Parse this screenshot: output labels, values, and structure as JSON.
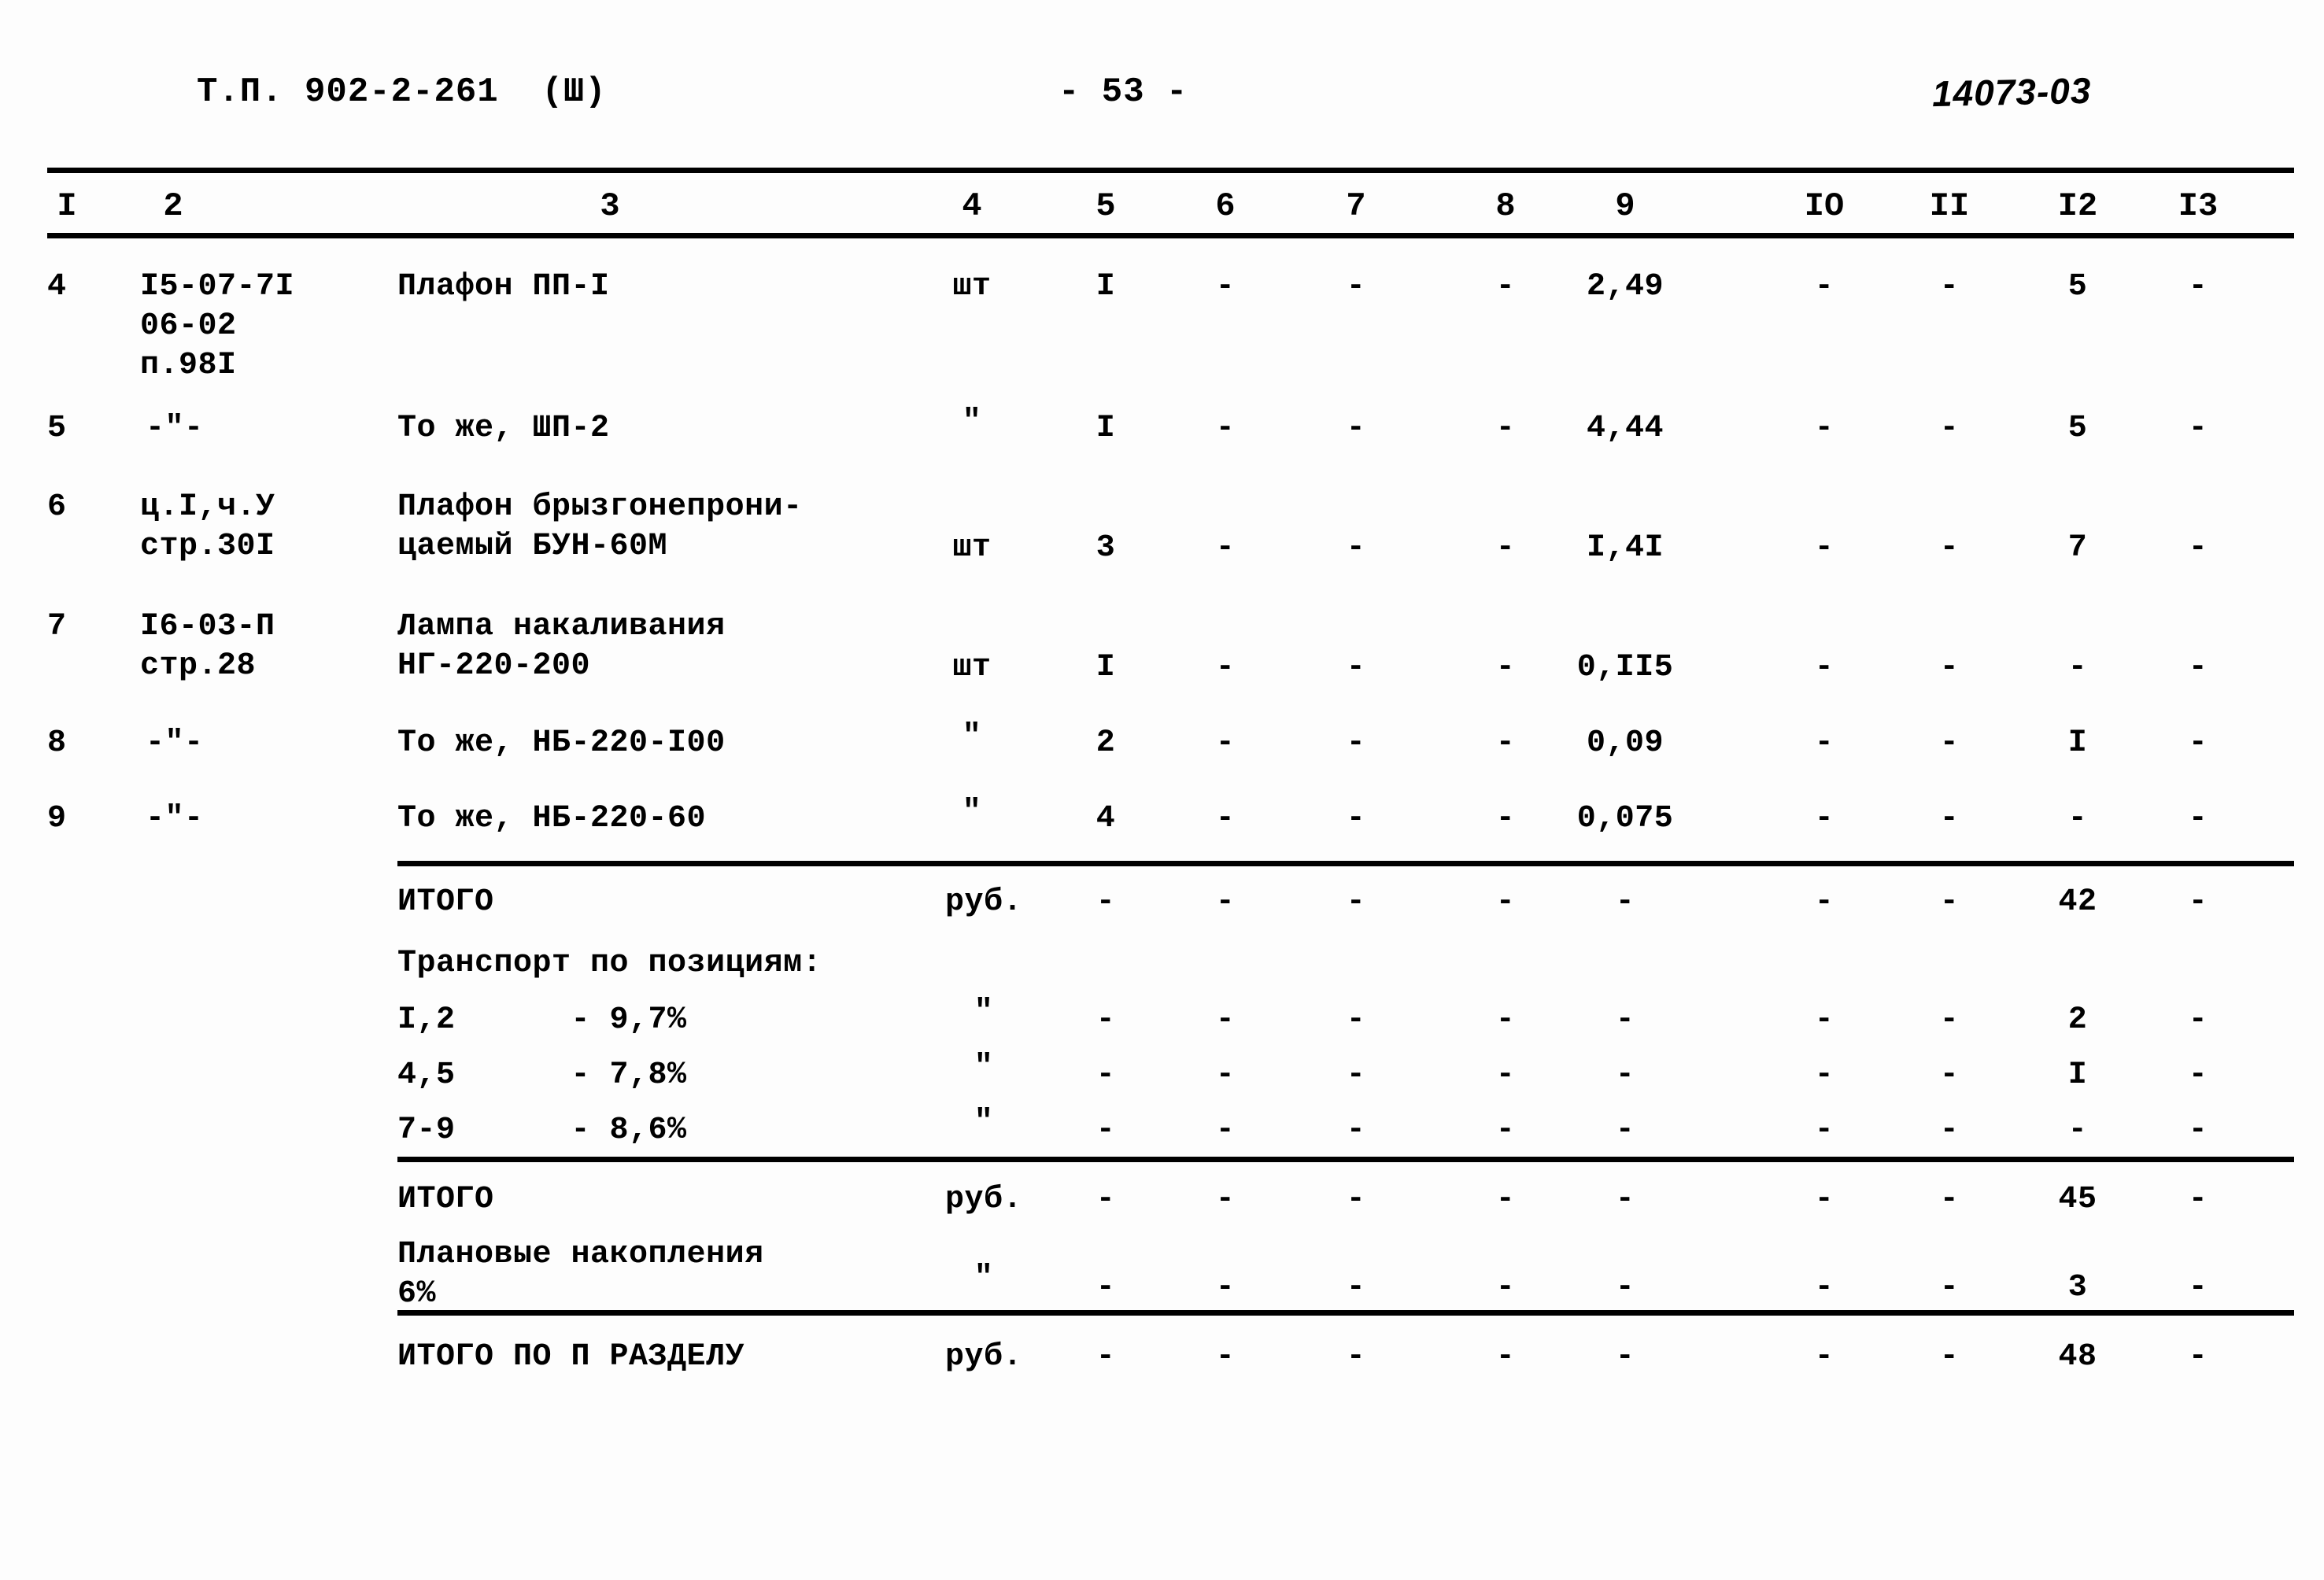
{
  "header": {
    "doc_code": "Т.П. 902-2-261  (Ш)",
    "page_number": "- 53 -",
    "drawing_number": "14073-03"
  },
  "table": {
    "column_headers": [
      "I",
      "2",
      "3",
      "4",
      "5",
      "6",
      "7",
      "8",
      "9",
      "IO",
      "II",
      "I2",
      "I3"
    ],
    "rows": [
      {
        "pos": "4",
        "ref": "I5-07-7I\n06-02\nп.98I",
        "name": "Плафон ПП-I",
        "unit": "шт",
        "qty": "I",
        "c6": "-",
        "c7": "-",
        "c8": "-",
        "c9": "2,49",
        "c10": "-",
        "c11": "-",
        "c12": "5",
        "c13": "-"
      },
      {
        "pos": "5",
        "ref": "-\"-",
        "name": "То же, ШП-2",
        "unit": "\"",
        "qty": "I",
        "c6": "-",
        "c7": "-",
        "c8": "-",
        "c9": "4,44",
        "c10": "-",
        "c11": "-",
        "c12": "5",
        "c13": "-"
      },
      {
        "pos": "6",
        "ref": "ц.I,ч.У\nстр.30I",
        "name": "Плафон брызгонепрони-\nцаемый БУН-60М",
        "unit": "шт",
        "qty": "3",
        "c6": "-",
        "c7": "-",
        "c8": "-",
        "c9": "I,4I",
        "c10": "-",
        "c11": "-",
        "c12": "7",
        "c13": "-"
      },
      {
        "pos": "7",
        "ref": "I6-03-П\nстр.28",
        "name": "Лампа накаливания\nНГ-220-200",
        "unit": "шт",
        "qty": "I",
        "c6": "-",
        "c7": "-",
        "c8": "-",
        "c9": "0,II5",
        "c10": "-",
        "c11": "-",
        "c12": "-",
        "c13": "-"
      },
      {
        "pos": "8",
        "ref": "-\"-",
        "name": "То же, НБ-220-I00",
        "unit": "\"",
        "qty": "2",
        "c6": "-",
        "c7": "-",
        "c8": "-",
        "c9": "0,09",
        "c10": "-",
        "c11": "-",
        "c12": "I",
        "c13": "-"
      },
      {
        "pos": "9",
        "ref": "-\"-",
        "name": "То же, НБ-220-60",
        "unit": "\"",
        "qty": "4",
        "c6": "-",
        "c7": "-",
        "c8": "-",
        "c9": "0,075",
        "c10": "-",
        "c11": "-",
        "c12": "-",
        "c13": "-"
      }
    ],
    "totals": [
      {
        "label": "ИТОГО",
        "unit": "руб.",
        "qty": "-",
        "c6": "-",
        "c7": "-",
        "c8": "-",
        "c9": "-",
        "c10": "-",
        "c11": "-",
        "c12": "42",
        "c13": "-"
      },
      {
        "label": "Транспорт по позициям:",
        "unit": "",
        "qty": "",
        "c6": "",
        "c7": "",
        "c8": "",
        "c9": "",
        "c10": "",
        "c11": "",
        "c12": "",
        "c13": ""
      },
      {
        "label": "I,2      - 9,7%",
        "unit": "\"",
        "qty": "-",
        "c6": "-",
        "c7": "-",
        "c8": "-",
        "c9": "-",
        "c10": "-",
        "c11": "-",
        "c12": "2",
        "c13": "-"
      },
      {
        "label": "4,5      - 7,8%",
        "unit": "\"",
        "qty": "-",
        "c6": "-",
        "c7": "-",
        "c8": "-",
        "c9": "-",
        "c10": "-",
        "c11": "-",
        "c12": "I",
        "c13": "-"
      },
      {
        "label": "7-9      - 8,6%",
        "unit": "\"",
        "qty": "-",
        "c6": "-",
        "c7": "-",
        "c8": "-",
        "c9": "-",
        "c10": "-",
        "c11": "-",
        "c12": "-",
        "c13": "-"
      },
      {
        "label": "ИТОГО",
        "unit": "руб.",
        "qty": "-",
        "c6": "-",
        "c7": "-",
        "c8": "-",
        "c9": "-",
        "c10": "-",
        "c11": "-",
        "c12": "45",
        "c13": "-"
      },
      {
        "label": "Плановые накопления\n6%",
        "unit": "\"",
        "qty": "-",
        "c6": "-",
        "c7": "-",
        "c8": "-",
        "c9": "-",
        "c10": "-",
        "c11": "-",
        "c12": "3",
        "c13": "-"
      },
      {
        "label": "ИТОГО ПО П РАЗДЕЛУ",
        "unit": "руб.",
        "qty": "-",
        "c6": "-",
        "c7": "-",
        "c8": "-",
        "c9": "-",
        "c10": "-",
        "c11": "-",
        "c12": "48",
        "c13": "-"
      }
    ]
  }
}
